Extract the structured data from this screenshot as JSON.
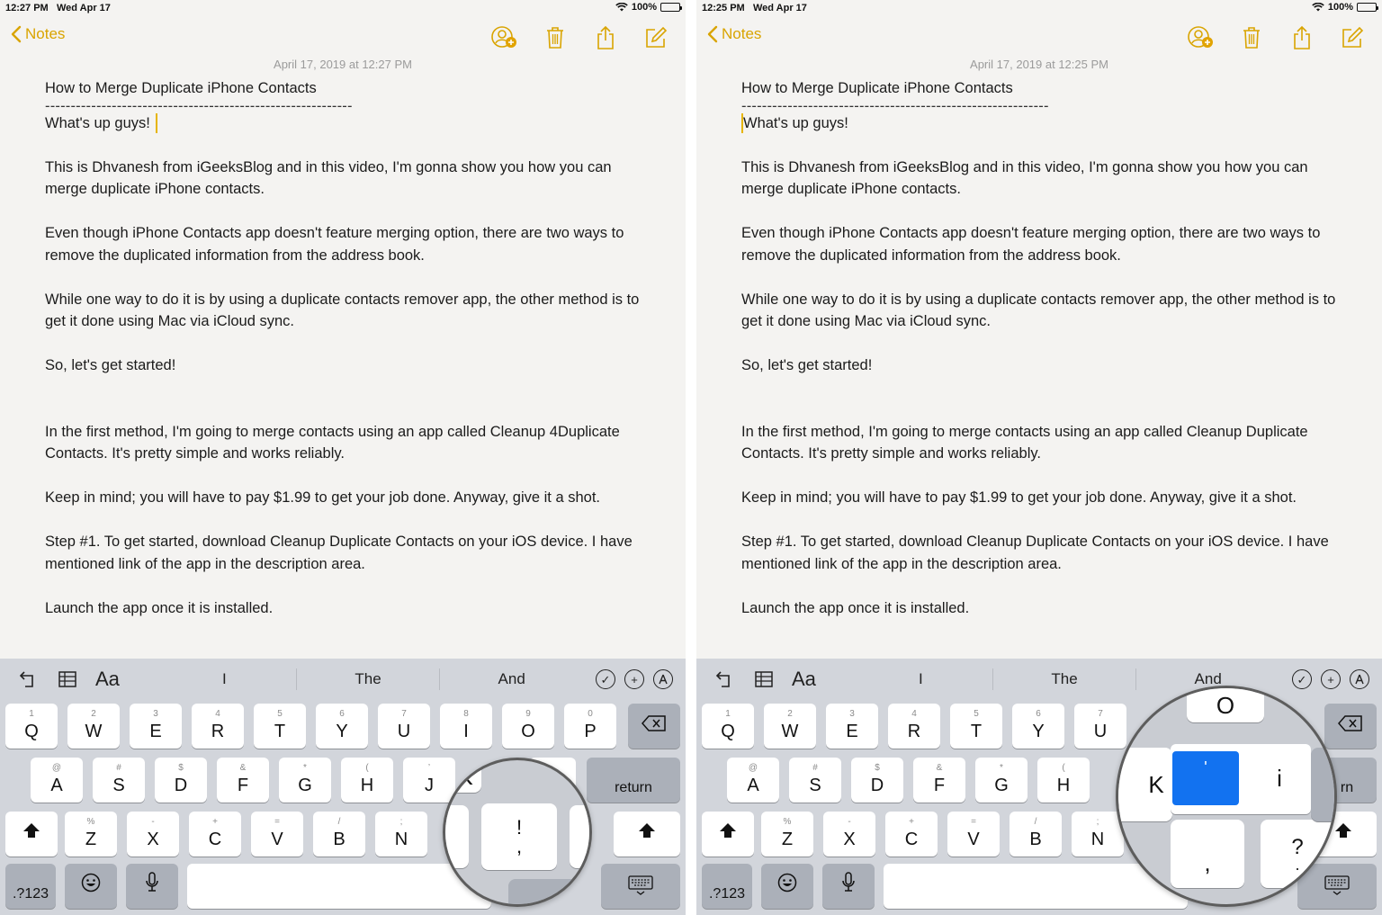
{
  "panes": [
    {
      "status": {
        "time": "12:27 PM",
        "date": "Wed Apr 17",
        "battery": "100%"
      },
      "nav": {
        "back_label": "Notes"
      },
      "note": {
        "date": "April 17, 2019 at 12:27 PM",
        "title": "How to Merge Duplicate iPhone Contacts",
        "separator": "------------------------------------------------------------",
        "greeting": "What's up guys!",
        "p1": "This is Dhvanesh from iGeeksBlog and in this video, I'm gonna show you how you can merge duplicate iPhone contacts.",
        "p2": "Even though iPhone Contacts app doesn't feature merging option, there are two ways to remove the duplicated information from the address book.",
        "p3": "While one way to do it is by using a duplicate contacts remover app, the other method is to get it done using Mac via iCloud sync.",
        "p4": "So, let's get started!",
        "p5": "In the first method, I'm going to merge contacts using an app called Cleanup 4Duplicate Contacts. It's pretty simple and works reliably.",
        "p6": "Keep in mind; you will have to pay $1.99 to get your job done. Anyway, give it a shot.",
        "p7": "Step #1. To get started, download Cleanup Duplicate Contacts on your iOS device.  I have mentioned link of the app in the description area.",
        "p8": "Launch the app once it is installed."
      },
      "keyboard": {
        "format_label": "Aa",
        "suggestions": [
          "I",
          "The",
          "And"
        ],
        "row1": [
          {
            "hint": "1",
            "key": "Q"
          },
          {
            "hint": "2",
            "key": "W"
          },
          {
            "hint": "3",
            "key": "E"
          },
          {
            "hint": "4",
            "key": "R"
          },
          {
            "hint": "5",
            "key": "T"
          },
          {
            "hint": "6",
            "key": "Y"
          },
          {
            "hint": "7",
            "key": "U"
          },
          {
            "hint": "8",
            "key": "I"
          },
          {
            "hint": "9",
            "key": "O"
          },
          {
            "hint": "0",
            "key": "P"
          }
        ],
        "row2": [
          {
            "hint": "@",
            "key": "A"
          },
          {
            "hint": "#",
            "key": "S"
          },
          {
            "hint": "$",
            "key": "D"
          },
          {
            "hint": "&",
            "key": "F"
          },
          {
            "hint": "*",
            "key": "G"
          },
          {
            "hint": "(",
            "key": "H"
          },
          {
            "hint": "’",
            "key": "J"
          }
        ],
        "row3": [
          {
            "hint": "%",
            "key": "Z"
          },
          {
            "hint": "-",
            "key": "X"
          },
          {
            "hint": "+",
            "key": "C"
          },
          {
            "hint": "=",
            "key": "V"
          },
          {
            "hint": "/",
            "key": "B"
          },
          {
            "hint": ";",
            "key": "N"
          }
        ],
        "return_label": "return",
        "numbers_label": ".?123",
        "magnifier": {
          "top": "!",
          "bottom": ",",
          "partial_top": "K",
          "partial_bottom": "."
        }
      }
    },
    {
      "status": {
        "time": "12:25 PM",
        "date": "Wed Apr 17",
        "battery": "100%"
      },
      "nav": {
        "back_label": "Notes"
      },
      "note": {
        "date": "April 17, 2019 at 12:25 PM",
        "title": "How to Merge Duplicate iPhone Contacts",
        "separator": "------------------------------------------------------------",
        "greeting": "What's up guys!",
        "p1": "This is Dhvanesh from iGeeksBlog and in this video, I'm gonna show you how you can merge duplicate iPhone contacts.",
        "p2": "Even though iPhone Contacts app doesn't feature merging option, there are two ways to remove the duplicated information from the address book.",
        "p3": "While one way to do it is by using a duplicate contacts remover app, the other method is to get it done using Mac via iCloud sync.",
        "p4": "So, let's get started!",
        "p5": "In the first method, I'm going to merge contacts using an app called Cleanup Duplicate Contacts. It's pretty simple and works reliably.",
        "p6": "Keep in mind; you will have to pay $1.99 to get your job done. Anyway, give it a shot.",
        "p7": "Step #1. To get started, download Cleanup Duplicate Contacts on your iOS device.  I have mentioned link of the app in the description area.",
        "p8": "Launch the app once it is installed."
      },
      "keyboard": {
        "format_label": "Aa",
        "suggestions": [
          "I",
          "The",
          "And"
        ],
        "row1": [
          {
            "hint": "1",
            "key": "Q"
          },
          {
            "hint": "2",
            "key": "W"
          },
          {
            "hint": "3",
            "key": "E"
          },
          {
            "hint": "4",
            "key": "R"
          },
          {
            "hint": "5",
            "key": "T"
          },
          {
            "hint": "6",
            "key": "Y"
          },
          {
            "hint": "7",
            "key": "U"
          }
        ],
        "row2": [
          {
            "hint": "@",
            "key": "A"
          },
          {
            "hint": "#",
            "key": "S"
          },
          {
            "hint": "$",
            "key": "D"
          },
          {
            "hint": "&",
            "key": "F"
          },
          {
            "hint": "*",
            "key": "G"
          },
          {
            "hint": "(",
            "key": "H"
          }
        ],
        "row3": [
          {
            "hint": "%",
            "key": "Z"
          },
          {
            "hint": "-",
            "key": "X"
          },
          {
            "hint": "+",
            "key": "C"
          },
          {
            "hint": "=",
            "key": "V"
          },
          {
            "hint": "/",
            "key": "B"
          },
          {
            "hint": ";",
            "key": "N"
          }
        ],
        "numbers_label": ".?123",
        "return_partial": "rn",
        "magnifier": {
          "top_key": "O",
          "left_key": "K",
          "selected": "'",
          "right_key": "i",
          "bottom_left": ",",
          "bottom_right": "?",
          "bottom_right_hint": "."
        }
      }
    }
  ]
}
